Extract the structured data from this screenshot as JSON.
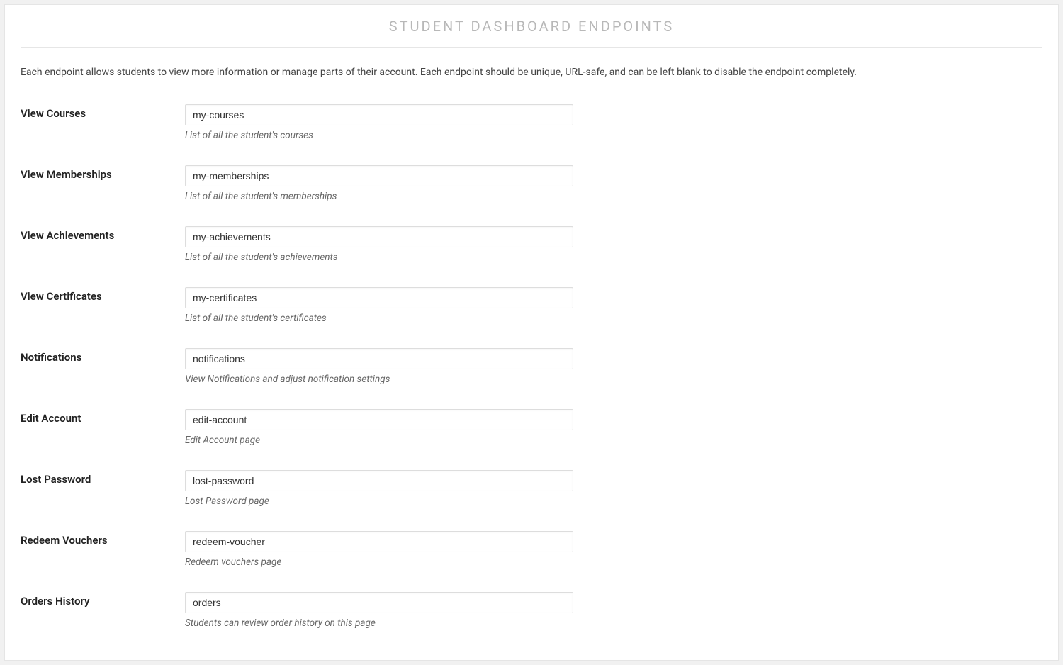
{
  "section": {
    "title": "STUDENT DASHBOARD ENDPOINTS",
    "intro": "Each endpoint allows students to view more information or manage parts of their account. Each endpoint should be unique, URL-safe, and can be left blank to disable the endpoint completely."
  },
  "fields": [
    {
      "label": "View Courses",
      "value": "my-courses",
      "desc": "List of all the student's courses"
    },
    {
      "label": "View Memberships",
      "value": "my-memberships",
      "desc": "List of all the student's memberships"
    },
    {
      "label": "View Achievements",
      "value": "my-achievements",
      "desc": "List of all the student's achievements"
    },
    {
      "label": "View Certificates",
      "value": "my-certificates",
      "desc": "List of all the student's certificates"
    },
    {
      "label": "Notifications",
      "value": "notifications",
      "desc": "View Notifications and adjust notification settings"
    },
    {
      "label": "Edit Account",
      "value": "edit-account",
      "desc": "Edit Account page"
    },
    {
      "label": "Lost Password",
      "value": "lost-password",
      "desc": "Lost Password page"
    },
    {
      "label": "Redeem Vouchers",
      "value": "redeem-voucher",
      "desc": "Redeem vouchers page"
    },
    {
      "label": "Orders History",
      "value": "orders",
      "desc": "Students can review order history on this page"
    }
  ]
}
